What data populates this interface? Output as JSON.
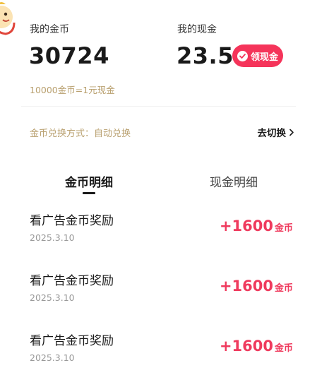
{
  "coins": {
    "label": "我的金币",
    "value": "30724",
    "rate_note": "10000金币=1元现金"
  },
  "cash": {
    "label": "我的现金",
    "value": "23.5",
    "button_label": "领现金",
    "button_icon": "cash-coin-icon"
  },
  "exchange": {
    "mode_text": "金币兑换方式：自动兑换",
    "switch_label": "去切换",
    "switch_icon": "chevron-right-icon"
  },
  "tabs": [
    {
      "label": "金币明细",
      "active": true
    },
    {
      "label": "现金明细",
      "active": false
    }
  ],
  "records": [
    {
      "title": "看广告金币奖励",
      "date": "2025.3.10",
      "amount": "+1600",
      "unit": "金币"
    },
    {
      "title": "看广告金币奖励",
      "date": "2025.3.10",
      "amount": "+1600",
      "unit": "金币"
    },
    {
      "title": "看广告金币奖励",
      "date": "2025.3.10",
      "amount": "+1600",
      "unit": "金币"
    }
  ],
  "colors": {
    "accent": "#f5345a",
    "amount": "#ef3a5d",
    "muted_gold": "#b9a06f"
  }
}
